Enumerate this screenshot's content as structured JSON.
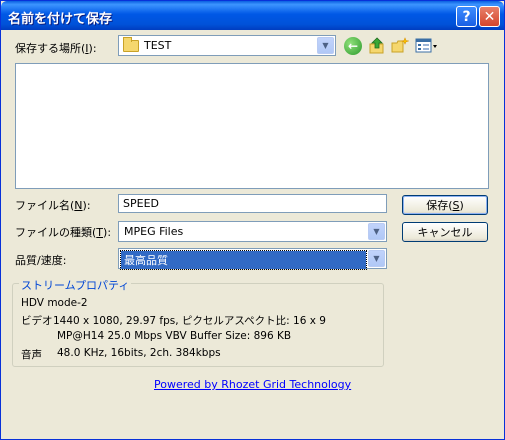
{
  "window": {
    "title": "名前を付けて保存",
    "help_label": "?",
    "close_label": "✕"
  },
  "save_in": {
    "label": "保存する場所(",
    "accel": "I",
    "label_end": "):",
    "value": "TEST",
    "folder_icon": "folder-icon"
  },
  "toolbar": {
    "back_icon": "back-icon",
    "up_icon": "up-folder-icon",
    "new_folder_icon": "new-folder-icon",
    "view_icon": "view-menu-icon"
  },
  "filename": {
    "label": "ファイル名(",
    "accel": "N",
    "label_end": "):",
    "value": "SPEED"
  },
  "filetype": {
    "label": "ファイルの種類(",
    "accel": "T",
    "label_end": "):",
    "value": "MPEG Files"
  },
  "quality": {
    "label": "品質/速度:",
    "value": "最高品質"
  },
  "buttons": {
    "save": "保存(",
    "save_accel": "S",
    "save_end": ")",
    "cancel": "キャンセル"
  },
  "stream_properties": {
    "title": "ストリームプロパティ",
    "format": "HDV mode-2",
    "video_label": "ビデオ",
    "video_value": "1440 x 1080, 29.97 fps, ピクセルアスペクト比:  16 x 9",
    "codec_line": "MP@H14 25.0 Mbps VBV Buffer Size: 896 KB",
    "audio_label": "音声",
    "audio_value": "48.0 KHz, 16bits, 2ch. 384kbps"
  },
  "footer": {
    "link": "Powered by Rhozet Grid Technology"
  },
  "colors": {
    "accent": "#0054e3",
    "link": "#0000ff",
    "selection": "#316ac5"
  }
}
